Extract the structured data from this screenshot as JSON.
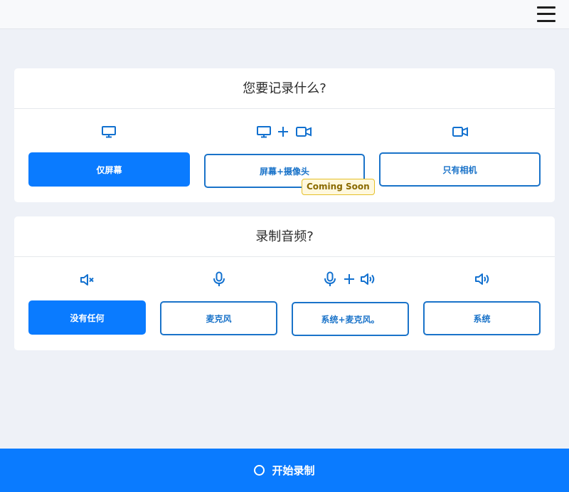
{
  "colors": {
    "primary": "#0a7bff",
    "outline": "#1a73c9",
    "badge_bg": "#fff8de",
    "badge_border": "#e5c02a"
  },
  "video_card": {
    "title": "您要记录什么?",
    "options": [
      {
        "label": "仅屏幕",
        "selected": true,
        "icons": [
          "monitor-icon"
        ]
      },
      {
        "label": "屏幕+摄像头",
        "selected": false,
        "icons": [
          "monitor-icon",
          "plus-icon",
          "video-camera-icon"
        ],
        "badge": "Coming Soon"
      },
      {
        "label": "只有相机",
        "selected": false,
        "icons": [
          "video-camera-icon"
        ]
      }
    ]
  },
  "audio_card": {
    "title": "录制音频?",
    "options": [
      {
        "label": "没有任何",
        "selected": true,
        "icons": [
          "speaker-muted-icon"
        ]
      },
      {
        "label": "麦克风",
        "selected": false,
        "icons": [
          "microphone-icon"
        ]
      },
      {
        "label": "系统+麦克风。",
        "selected": false,
        "icons": [
          "microphone-icon",
          "plus-icon",
          "speaker-icon"
        ]
      },
      {
        "label": "系统",
        "selected": false,
        "icons": [
          "speaker-icon"
        ]
      }
    ]
  },
  "footer": {
    "start_label": "开始录制",
    "icon": "record-circle-icon"
  },
  "topbar": {
    "menu_icon": "hamburger-menu-icon"
  }
}
